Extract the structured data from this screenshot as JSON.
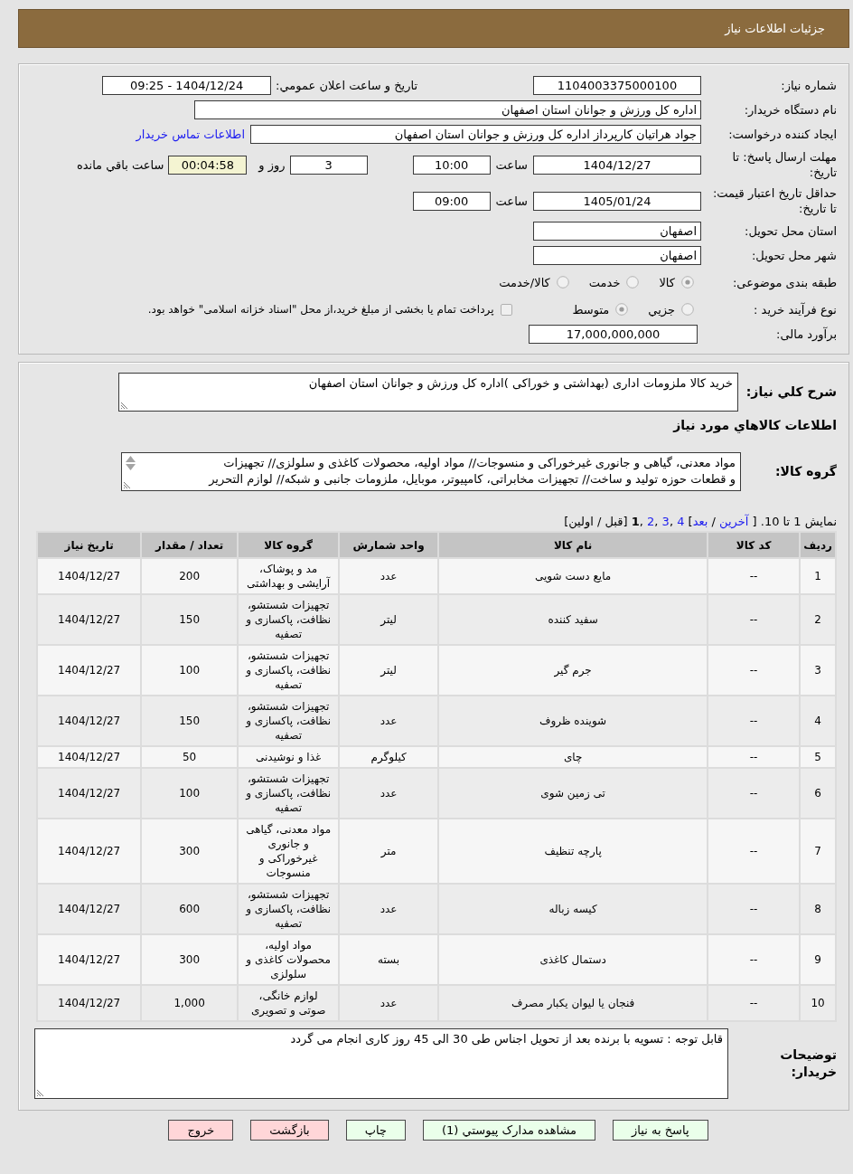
{
  "header": {
    "title": "جزئیات اطلاعات نیاز"
  },
  "details": {
    "need_number": {
      "label": "شماره نیاز:",
      "value": "1104003375000100"
    },
    "announcement": {
      "label": "تاریخ و ساعت اعلان عمومي:",
      "value": "1404/12/24 - 09:25"
    },
    "buyer_org": {
      "label": "نام دستگاه خریدار:",
      "value": "اداره کل ورزش و جوانان استان اصفهان"
    },
    "requester": {
      "label": "ایجاد کننده درخواست:",
      "value": "جواد هراتیان کارپرداز اداره کل ورزش و جوانان استان اصفهان",
      "link": "اطلاعات تماس خریدار"
    },
    "response_deadline": {
      "label": "مهلت ارسال پاسخ: تا تاریخ:",
      "date": "1404/12/27",
      "time_label": "ساعت",
      "time": "10:00",
      "days": "3",
      "days_label": "روز و",
      "remaining": "00:04:58",
      "remaining_label": "ساعت باقي مانده"
    },
    "price_validity": {
      "label": "حداقل تاریخ اعتبار قیمت: تا تاریخ:",
      "date": "1405/01/24",
      "time_label": "ساعت",
      "time": "09:00"
    },
    "delivery_province": {
      "label": "استان محل تحویل:",
      "value": "اصفهان"
    },
    "delivery_city": {
      "label": "شهر محل تحویل:",
      "value": "اصفهان"
    },
    "category": {
      "label": "طبقه بندی موضوعی:",
      "options": [
        {
          "label": "کالا",
          "selected": true
        },
        {
          "label": "خدمت",
          "selected": false
        },
        {
          "label": "کالا/خدمت",
          "selected": false
        }
      ]
    },
    "purchase_process": {
      "label": "نوع فرآیند خرید :",
      "options": [
        {
          "label": "جزيي",
          "selected": false
        },
        {
          "label": "متوسط",
          "selected": true
        }
      ],
      "treasury_note": {
        "label": "پرداخت تمام یا بخشی از مبلغ خرید،از محل \"اسناد خزانه اسلامی\" خواهد بود.",
        "checked": false
      }
    },
    "budget": {
      "label": "برآورد مالی:",
      "value": "17,000,000,000"
    }
  },
  "needs": {
    "description": {
      "label": "شرح کلي نیاز:",
      "value": "خرید کالا ملزومات اداری (بهداشتی و خوراکی )اداره کل ورزش و جوانان استان اصفهان"
    },
    "goods_heading": "اطلاعات کالاهاي مورد نیاز",
    "goods_group": {
      "label": "گروه کالا:",
      "lines": [
        "مواد معدنی، گیاهی و جانوری غیرخوراکی و منسوجات// مواد اولیه، محصولات کاغذی و سلولزی// تجهیزات",
        "و قطعات حوزه تولید و ساخت// تجهیزات مخابراتی، کامپیوتر، موبایل، ملزومات جانبی و شبکه// لوازم التحریر"
      ]
    },
    "pagination": [
      {
        "kind": "text",
        "text": "نمایش 1 تا 10."
      },
      {
        "kind": "text",
        "text": "["
      },
      {
        "kind": "link",
        "text": "آخرین"
      },
      {
        "kind": "text",
        "text": "/"
      },
      {
        "kind": "link",
        "text": "بعد"
      },
      {
        "kind": "close",
        "text": "]"
      },
      {
        "kind": "page",
        "text": "4",
        "selected": false
      },
      {
        "kind": "sep",
        "text": ","
      },
      {
        "kind": "page",
        "text": "3",
        "selected": false
      },
      {
        "kind": "sep",
        "text": ","
      },
      {
        "kind": "page",
        "text": "2",
        "selected": false
      },
      {
        "kind": "sep",
        "text": ","
      },
      {
        "kind": "page",
        "text": "1",
        "selected": true
      },
      {
        "kind": "text",
        "text": "[قبل / اولین]"
      }
    ],
    "table": {
      "columns": [
        "ردیف",
        "کد کالا",
        "نام کالا",
        "واحد شمارش",
        "گروه کالا",
        "تعداد / مقدار",
        "تاریخ نیاز"
      ],
      "rows": [
        [
          "1",
          "--",
          "مایع دست شویی",
          "عدد",
          "مد و پوشاک، آرایشی و بهداشتی",
          "200",
          "1404/12/27"
        ],
        [
          "2",
          "--",
          "سفید کننده",
          "لیتر",
          "تجهیزات شستشو، نظافت، پاکسازی و تصفیه",
          "150",
          "1404/12/27"
        ],
        [
          "3",
          "--",
          "جرم گیر",
          "لیتر",
          "تجهیزات شستشو، نظافت، پاکسازی و تصفیه",
          "100",
          "1404/12/27"
        ],
        [
          "4",
          "--",
          "شوینده ظروف",
          "عدد",
          "تجهیزات شستشو، نظافت، پاکسازی و تصفیه",
          "150",
          "1404/12/27"
        ],
        [
          "5",
          "--",
          "چای",
          "کیلوگرم",
          "غذا و نوشیدنی",
          "50",
          "1404/12/27"
        ],
        [
          "6",
          "--",
          "تی زمین شوی",
          "عدد",
          "تجهیزات شستشو، نظافت، پاکسازی و تصفیه",
          "100",
          "1404/12/27"
        ],
        [
          "7",
          "--",
          "پارچه تنظیف",
          "متر",
          "مواد معدنی، گیاهی و جانوری غیرخوراکی و منسوجات",
          "300",
          "1404/12/27"
        ],
        [
          "8",
          "--",
          "کیسه زباله",
          "عدد",
          "تجهیزات شستشو، نظافت، پاکسازی و تصفیه",
          "600",
          "1404/12/27"
        ],
        [
          "9",
          "--",
          "دستمال کاغذی",
          "بسته",
          "مواد اولیه، محصولات کاغذی و سلولزی",
          "300",
          "1404/12/27"
        ],
        [
          "10",
          "--",
          "فنجان یا لیوان یکبار مصرف",
          "عدد",
          "لوازم خانگی، صوتی و تصویری",
          "1,000",
          "1404/12/27"
        ]
      ]
    },
    "buyer_notes": {
      "label": "توضیحات خریدار:",
      "value": "قابل توجه : تسویه با برنده بعد از تحویل اجناس طی 30 الی 45 روز کاری انجام می گردد"
    }
  },
  "buttons": [
    {
      "label": "پاسخ به نیاز",
      "kind": "action"
    },
    {
      "label": "مشاهده مدارک پیوستي (1)",
      "kind": "action"
    },
    {
      "label": "چاپ",
      "kind": "action"
    },
    {
      "label": "بازگشت",
      "kind": "exit"
    },
    {
      "label": "خروج",
      "kind": "exit"
    }
  ]
}
